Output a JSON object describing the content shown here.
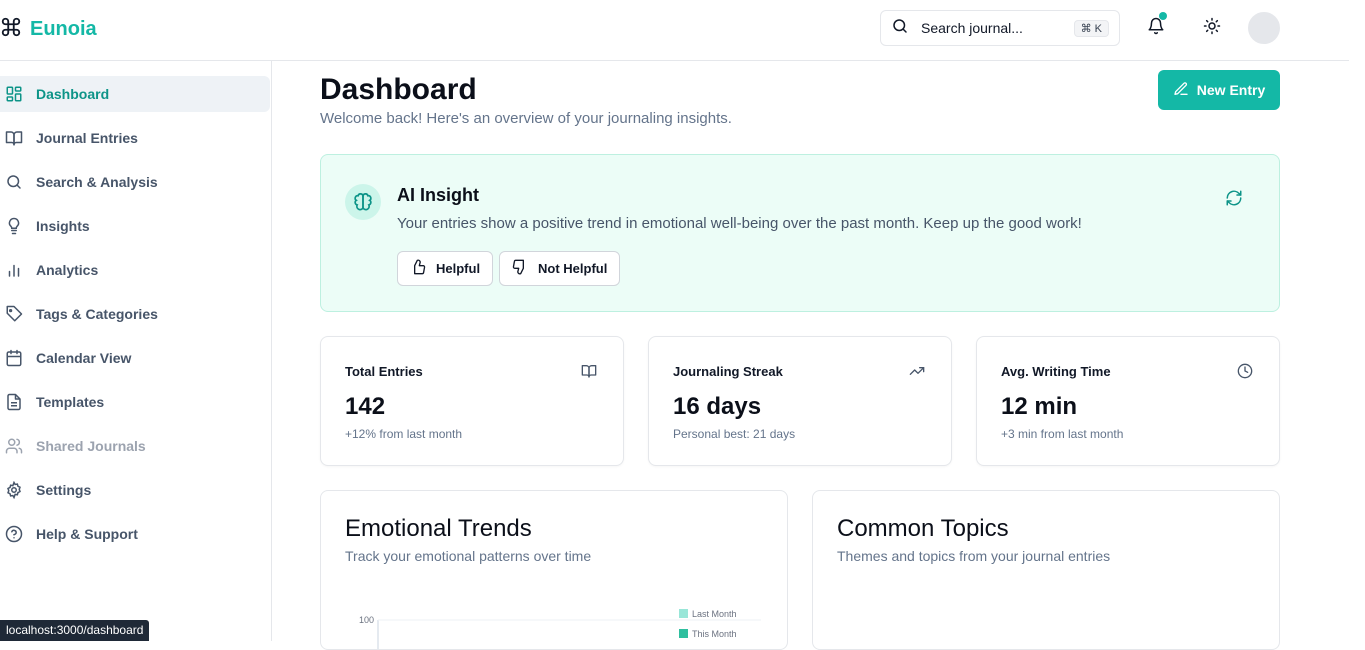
{
  "brand": {
    "name": "Eunoia"
  },
  "search": {
    "placeholder": "Search journal...",
    "shortcut": "⌘ K"
  },
  "sidebar": {
    "items": [
      {
        "label": "Dashboard",
        "icon": "grid-icon",
        "active": true
      },
      {
        "label": "Journal Entries",
        "icon": "book-icon"
      },
      {
        "label": "Search & Analysis",
        "icon": "search-icon"
      },
      {
        "label": "Insights",
        "icon": "lightbulb-icon"
      },
      {
        "label": "Analytics",
        "icon": "bar-chart-icon"
      },
      {
        "label": "Tags & Categories",
        "icon": "tag-icon"
      },
      {
        "label": "Calendar View",
        "icon": "calendar-icon"
      },
      {
        "label": "Templates",
        "icon": "file-text-icon"
      },
      {
        "label": "Shared Journals",
        "icon": "users-icon",
        "disabled": true
      },
      {
        "label": "Settings",
        "icon": "gear-icon"
      },
      {
        "label": "Help & Support",
        "icon": "help-circle-icon"
      }
    ]
  },
  "status_url": "localhost:3000/dashboard",
  "page": {
    "title": "Dashboard",
    "subtitle": "Welcome back! Here's an overview of your journaling insights.",
    "new_entry_label": "New Entry"
  },
  "insight": {
    "title": "AI Insight",
    "text": "Your entries show a positive trend in emotional well-being over the past month. Keep up the good work!",
    "helpful_label": "Helpful",
    "not_helpful_label": "Not Helpful"
  },
  "stats": [
    {
      "label": "Total Entries",
      "value": "142",
      "note": "+12% from last month",
      "icon": "book-open-icon"
    },
    {
      "label": "Journaling Streak",
      "value": "16 days",
      "note": "Personal best: 21 days",
      "icon": "trending-up-icon"
    },
    {
      "label": "Avg. Writing Time",
      "value": "12 min",
      "note": "+3 min from last month",
      "icon": "clock-icon"
    }
  ],
  "panels": {
    "emotional": {
      "title": "Emotional Trends",
      "subtitle": "Track your emotional patterns over time"
    },
    "topics": {
      "title": "Common Topics",
      "subtitle": "Themes and topics from your journal entries"
    }
  },
  "chart_data": {
    "type": "bar",
    "series": [
      {
        "name": "Last Month",
        "color": "#99e6d8"
      },
      {
        "name": "This Month",
        "color": "#2fbf9f"
      }
    ],
    "yticks": [
      "100"
    ]
  },
  "colors": {
    "accent": "#14b8a6",
    "insight_bg": "#ecfdf7"
  }
}
